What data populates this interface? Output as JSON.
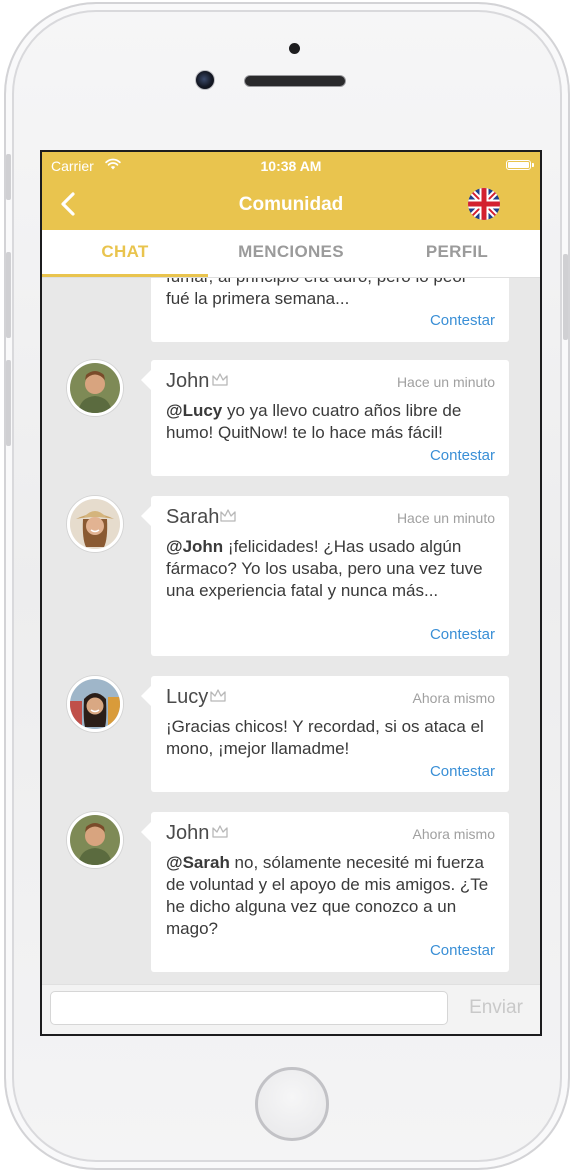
{
  "status_bar": {
    "carrier": "Carrier",
    "time": "10:38 AM"
  },
  "header": {
    "title": "Comunidad"
  },
  "tabs": [
    {
      "label": "CHAT",
      "active": true
    },
    {
      "label": "MENCIONES",
      "active": false
    },
    {
      "label": "PERFIL",
      "active": false
    }
  ],
  "messages": [
    {
      "text_partial_top": "fumar, al principio era duro, pero lo peor",
      "text_rest": "fué la primera semana...",
      "reply_label": "Contestar"
    },
    {
      "name": "John",
      "time": "Hace un minuto",
      "mention": "@Lucy",
      "text": " yo ya llevo cuatro años libre de humo! QuitNow! te lo hace más fácil!",
      "reply_label": "Contestar"
    },
    {
      "name": "Sarah",
      "time": "Hace un minuto",
      "mention": "@John",
      "text": " ¡felicidades! ¿Has usado algún fármaco? Yo los usaba, pero una vez tuve una experiencia fatal y nunca más...",
      "reply_label": "Contestar"
    },
    {
      "name": "Lucy",
      "time": "Ahora mismo",
      "mention": "",
      "text": "¡Gracias chicos! Y recordad, si os ataca el mono, ¡mejor llamadme!",
      "reply_label": "Contestar"
    },
    {
      "name": "John",
      "time": "Ahora mismo",
      "mention": "@Sarah",
      "text": " no, sólamente necesité mi fuerza de voluntad y el apoyo de mis amigos. ¿Te he dicho alguna vez que conozco a un mago?",
      "reply_label": "Contestar"
    }
  ],
  "input": {
    "value": "",
    "placeholder": ""
  },
  "send_label": "Enviar",
  "colors": {
    "accent": "#e9c44e",
    "link": "#3a8fd6",
    "background": "#e8e8e8"
  },
  "icons": {
    "back": "chevron-left-icon",
    "flag": "uk-flag-icon",
    "crown": "crown-outline-icon",
    "wifi": "wifi-icon",
    "battery": "battery-icon"
  }
}
